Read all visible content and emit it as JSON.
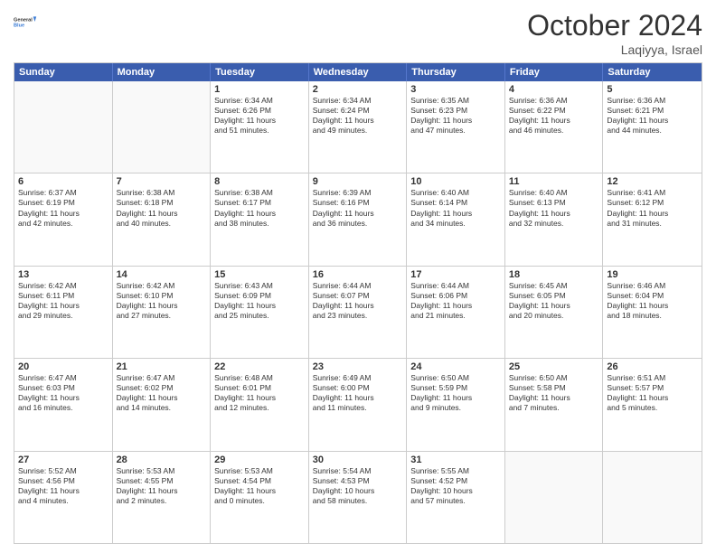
{
  "header": {
    "logo_line1": "General",
    "logo_line2": "Blue",
    "title": "October 2024",
    "location": "Laqiyya, Israel"
  },
  "day_headers": [
    "Sunday",
    "Monday",
    "Tuesday",
    "Wednesday",
    "Thursday",
    "Friday",
    "Saturday"
  ],
  "weeks": [
    {
      "days": [
        {
          "num": "",
          "empty": true
        },
        {
          "num": "",
          "empty": true
        },
        {
          "num": "1",
          "info": "Sunrise: 6:34 AM\nSunset: 6:26 PM\nDaylight: 11 hours\nand 51 minutes."
        },
        {
          "num": "2",
          "info": "Sunrise: 6:34 AM\nSunset: 6:24 PM\nDaylight: 11 hours\nand 49 minutes."
        },
        {
          "num": "3",
          "info": "Sunrise: 6:35 AM\nSunset: 6:23 PM\nDaylight: 11 hours\nand 47 minutes."
        },
        {
          "num": "4",
          "info": "Sunrise: 6:36 AM\nSunset: 6:22 PM\nDaylight: 11 hours\nand 46 minutes."
        },
        {
          "num": "5",
          "info": "Sunrise: 6:36 AM\nSunset: 6:21 PM\nDaylight: 11 hours\nand 44 minutes."
        }
      ]
    },
    {
      "days": [
        {
          "num": "6",
          "info": "Sunrise: 6:37 AM\nSunset: 6:19 PM\nDaylight: 11 hours\nand 42 minutes."
        },
        {
          "num": "7",
          "info": "Sunrise: 6:38 AM\nSunset: 6:18 PM\nDaylight: 11 hours\nand 40 minutes."
        },
        {
          "num": "8",
          "info": "Sunrise: 6:38 AM\nSunset: 6:17 PM\nDaylight: 11 hours\nand 38 minutes."
        },
        {
          "num": "9",
          "info": "Sunrise: 6:39 AM\nSunset: 6:16 PM\nDaylight: 11 hours\nand 36 minutes."
        },
        {
          "num": "10",
          "info": "Sunrise: 6:40 AM\nSunset: 6:14 PM\nDaylight: 11 hours\nand 34 minutes."
        },
        {
          "num": "11",
          "info": "Sunrise: 6:40 AM\nSunset: 6:13 PM\nDaylight: 11 hours\nand 32 minutes."
        },
        {
          "num": "12",
          "info": "Sunrise: 6:41 AM\nSunset: 6:12 PM\nDaylight: 11 hours\nand 31 minutes."
        }
      ]
    },
    {
      "days": [
        {
          "num": "13",
          "info": "Sunrise: 6:42 AM\nSunset: 6:11 PM\nDaylight: 11 hours\nand 29 minutes."
        },
        {
          "num": "14",
          "info": "Sunrise: 6:42 AM\nSunset: 6:10 PM\nDaylight: 11 hours\nand 27 minutes."
        },
        {
          "num": "15",
          "info": "Sunrise: 6:43 AM\nSunset: 6:09 PM\nDaylight: 11 hours\nand 25 minutes."
        },
        {
          "num": "16",
          "info": "Sunrise: 6:44 AM\nSunset: 6:07 PM\nDaylight: 11 hours\nand 23 minutes."
        },
        {
          "num": "17",
          "info": "Sunrise: 6:44 AM\nSunset: 6:06 PM\nDaylight: 11 hours\nand 21 minutes."
        },
        {
          "num": "18",
          "info": "Sunrise: 6:45 AM\nSunset: 6:05 PM\nDaylight: 11 hours\nand 20 minutes."
        },
        {
          "num": "19",
          "info": "Sunrise: 6:46 AM\nSunset: 6:04 PM\nDaylight: 11 hours\nand 18 minutes."
        }
      ]
    },
    {
      "days": [
        {
          "num": "20",
          "info": "Sunrise: 6:47 AM\nSunset: 6:03 PM\nDaylight: 11 hours\nand 16 minutes."
        },
        {
          "num": "21",
          "info": "Sunrise: 6:47 AM\nSunset: 6:02 PM\nDaylight: 11 hours\nand 14 minutes."
        },
        {
          "num": "22",
          "info": "Sunrise: 6:48 AM\nSunset: 6:01 PM\nDaylight: 11 hours\nand 12 minutes."
        },
        {
          "num": "23",
          "info": "Sunrise: 6:49 AM\nSunset: 6:00 PM\nDaylight: 11 hours\nand 11 minutes."
        },
        {
          "num": "24",
          "info": "Sunrise: 6:50 AM\nSunset: 5:59 PM\nDaylight: 11 hours\nand 9 minutes."
        },
        {
          "num": "25",
          "info": "Sunrise: 6:50 AM\nSunset: 5:58 PM\nDaylight: 11 hours\nand 7 minutes."
        },
        {
          "num": "26",
          "info": "Sunrise: 6:51 AM\nSunset: 5:57 PM\nDaylight: 11 hours\nand 5 minutes."
        }
      ]
    },
    {
      "days": [
        {
          "num": "27",
          "info": "Sunrise: 5:52 AM\nSunset: 4:56 PM\nDaylight: 11 hours\nand 4 minutes."
        },
        {
          "num": "28",
          "info": "Sunrise: 5:53 AM\nSunset: 4:55 PM\nDaylight: 11 hours\nand 2 minutes."
        },
        {
          "num": "29",
          "info": "Sunrise: 5:53 AM\nSunset: 4:54 PM\nDaylight: 11 hours\nand 0 minutes."
        },
        {
          "num": "30",
          "info": "Sunrise: 5:54 AM\nSunset: 4:53 PM\nDaylight: 10 hours\nand 58 minutes."
        },
        {
          "num": "31",
          "info": "Sunrise: 5:55 AM\nSunset: 4:52 PM\nDaylight: 10 hours\nand 57 minutes."
        },
        {
          "num": "",
          "empty": true
        },
        {
          "num": "",
          "empty": true
        }
      ]
    }
  ]
}
